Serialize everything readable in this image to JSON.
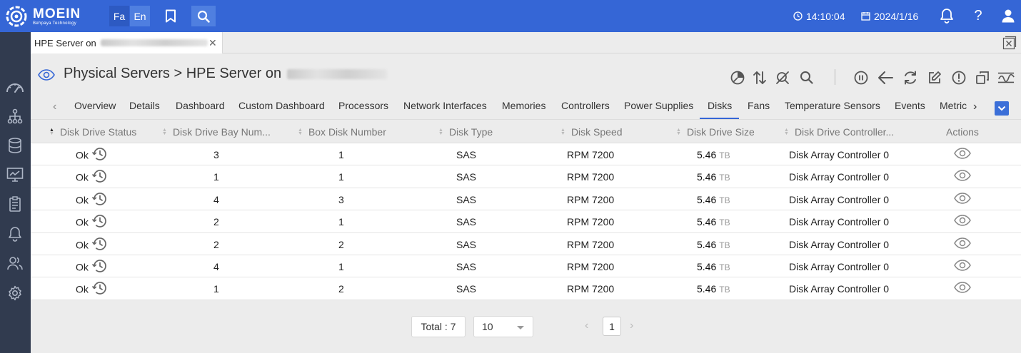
{
  "app": {
    "brand": "MOEIN",
    "brand_sub": "Behpaya Technology",
    "lang_fa": "Fa",
    "lang_en": "En",
    "time": "14:10:04",
    "date": "2024/1/16",
    "help": "?"
  },
  "tab": {
    "label": "HPE Server on"
  },
  "page": {
    "title": "Physical Servers > HPE Server on"
  },
  "nav": {
    "items": [
      "Overview",
      "Details",
      "Dashboard",
      "Custom Dashboard",
      "Processors",
      "Network Interfaces",
      "Memories",
      "Controllers",
      "Power Supplies",
      "Disks",
      "Fans",
      "Temperature Sensors",
      "Events",
      "Metric"
    ],
    "active": "Disks"
  },
  "table": {
    "columns": [
      "Disk Drive Status",
      "Disk Drive Bay Num...",
      "Box Disk Number",
      "Disk Type",
      "Disk Speed",
      "Disk Drive Size",
      "Disk Drive Controller...",
      "Actions"
    ],
    "rows": [
      {
        "status": "Ok",
        "bay": "3",
        "box": "1",
        "type": "SAS",
        "speed": "RPM 7200",
        "size": "5.46",
        "unit": "TB",
        "controller": "Disk Array Controller 0"
      },
      {
        "status": "Ok",
        "bay": "1",
        "box": "1",
        "type": "SAS",
        "speed": "RPM 7200",
        "size": "5.46",
        "unit": "TB",
        "controller": "Disk Array Controller 0"
      },
      {
        "status": "Ok",
        "bay": "4",
        "box": "3",
        "type": "SAS",
        "speed": "RPM 7200",
        "size": "5.46",
        "unit": "TB",
        "controller": "Disk Array Controller 0"
      },
      {
        "status": "Ok",
        "bay": "2",
        "box": "1",
        "type": "SAS",
        "speed": "RPM 7200",
        "size": "5.46",
        "unit": "TB",
        "controller": "Disk Array Controller 0"
      },
      {
        "status": "Ok",
        "bay": "2",
        "box": "2",
        "type": "SAS",
        "speed": "RPM 7200",
        "size": "5.46",
        "unit": "TB",
        "controller": "Disk Array Controller 0"
      },
      {
        "status": "Ok",
        "bay": "4",
        "box": "1",
        "type": "SAS",
        "speed": "RPM 7200",
        "size": "5.46",
        "unit": "TB",
        "controller": "Disk Array Controller 0"
      },
      {
        "status": "Ok",
        "bay": "1",
        "box": "2",
        "type": "SAS",
        "speed": "RPM 7200",
        "size": "5.46",
        "unit": "TB",
        "controller": "Disk Array Controller 0"
      }
    ]
  },
  "pagination": {
    "total_label": "Total :",
    "total": "7",
    "page_size": "10",
    "current_page": "1"
  },
  "colors": {
    "topbar": "#3566d6",
    "sidebar": "#313b4f",
    "accent": "#3566d6"
  },
  "icons": {
    "toolbar": [
      "pie-chart-icon",
      "sort-icon",
      "filter-off-icon",
      "search-icon",
      "pause-icon",
      "back-arrow-icon",
      "refresh-icon",
      "edit-icon",
      "alert-icon",
      "copy-icon",
      "signal-icon"
    ],
    "sidebar": [
      "gauge-icon",
      "topology-icon",
      "database-icon",
      "monitor-icon",
      "clipboard-icon",
      "bell-icon",
      "users-icon",
      "settings-icon"
    ]
  }
}
